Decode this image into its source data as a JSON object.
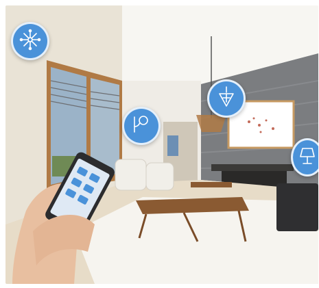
{
  "scene": {
    "colors": {
      "hotspot": "#4a92d9",
      "wall": "#f4f3ef",
      "stone": "#7b7d80",
      "floor": "#e7dcc8",
      "wood": "#b07a45"
    }
  },
  "hotspots": [
    {
      "id": "chandelier",
      "icon": "chandelier-icon"
    },
    {
      "id": "wall-lamp",
      "icon": "wall-lamp-icon"
    },
    {
      "id": "pendant",
      "icon": "pendant-lamp-icon"
    },
    {
      "id": "table-lamp",
      "icon": "table-lamp-icon"
    }
  ],
  "phone": {
    "icon": "smart-home-app-icon"
  }
}
